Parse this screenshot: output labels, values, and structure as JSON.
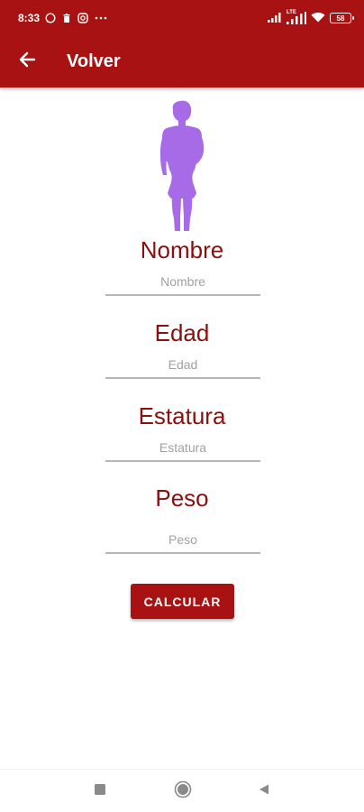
{
  "status_bar": {
    "time": "8:33",
    "notification_icons": [
      "whatsapp-icon",
      "trash-icon",
      "instagram-icon",
      "more-icon"
    ],
    "network_label": "LTE",
    "battery_level": "58"
  },
  "app_bar": {
    "title": "Volver",
    "background": "#a81212"
  },
  "avatar": {
    "icon": "female-silhouette-icon",
    "color": "#a86be8"
  },
  "form": {
    "nombre": {
      "label": "Nombre",
      "placeholder": "Nombre",
      "value": ""
    },
    "edad": {
      "label": "Edad",
      "placeholder": "Edad",
      "value": ""
    },
    "estatura": {
      "label": "Estatura",
      "placeholder": "Estatura",
      "value": ""
    },
    "peso": {
      "label": "Peso",
      "placeholder": "Peso",
      "value": ""
    },
    "label_color": "#8b0f0f"
  },
  "actions": {
    "calcular_label": "CALCULAR"
  },
  "nav_bar": {
    "icons": [
      "recents-icon",
      "home-icon",
      "back-triangle-icon"
    ]
  }
}
